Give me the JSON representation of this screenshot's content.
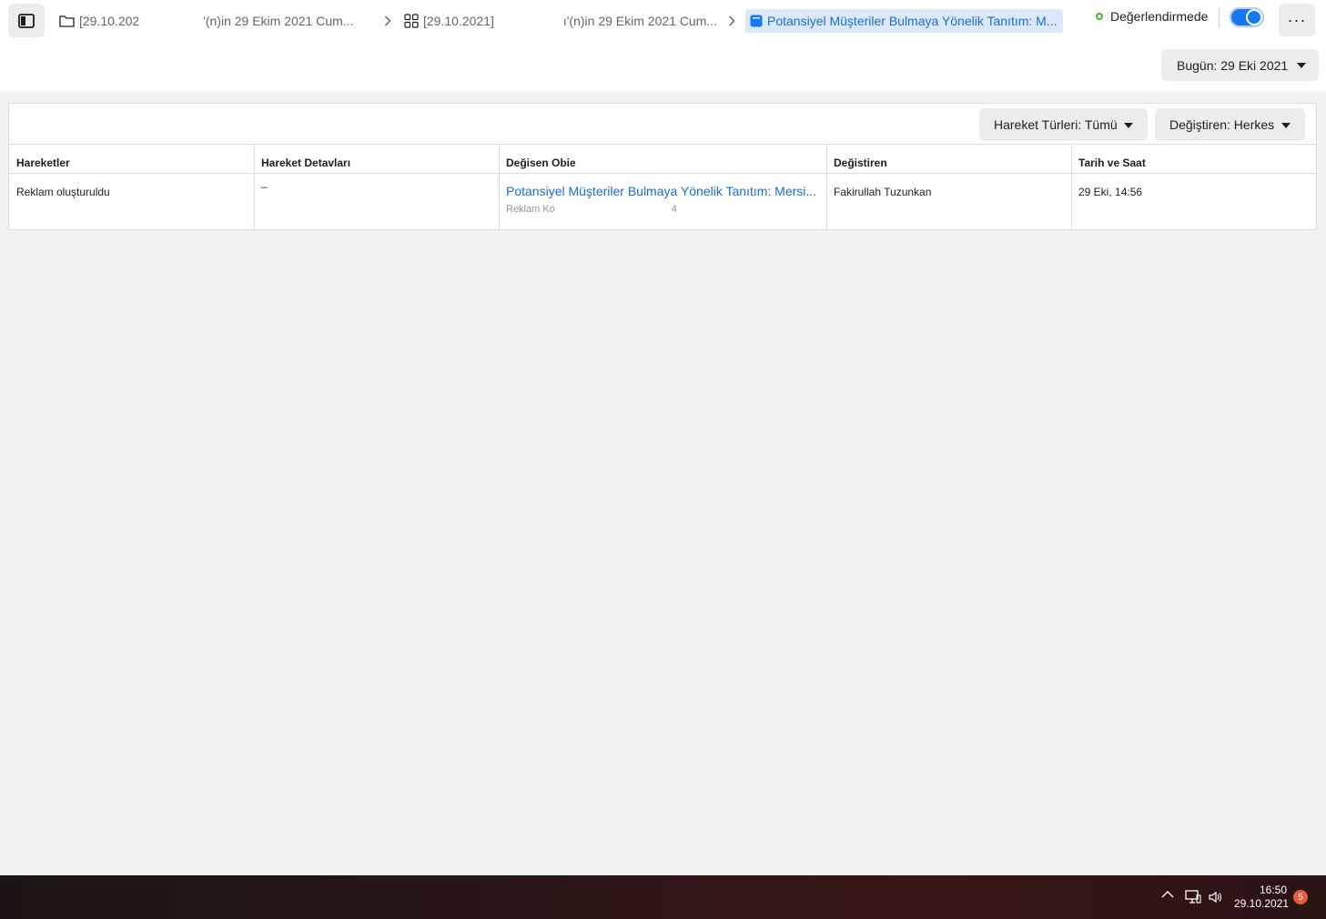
{
  "header": {
    "breadcrumbs": [
      {
        "text_start": "[29.10.202",
        "text_end": "'(n)in 29 Ekim 2021 Cum..."
      },
      {
        "text_start": "[29.10.2021]",
        "text_end": "ı'(n)in 29 Ekim 2021 Cum..."
      }
    ],
    "active_crumb": "Potansiyel Müşteriler Bulmaya Yönelik Tanıtım: M...",
    "status_label": "Değerlendirmede",
    "status_color": "#44b232",
    "toggle_on": true,
    "more_label": "···",
    "date_button": "Bugün: 29 Eki 2021"
  },
  "filters": {
    "action_types": "Hareket Türleri: Tümü",
    "changed_by": "Değiştiren: Herkes"
  },
  "table": {
    "headers": [
      "Hareketler",
      "Hareket Detavları",
      "Değisen Obie",
      "Değistiren",
      "Tarih ve Saat"
    ],
    "rows": [
      {
        "action": "Reklam oluşturuldu",
        "details": "–",
        "object_title": "Potansiyel Müşteriler Bulmaya Yönelik Tanıtım: Mersi...",
        "object_sub": "Reklam Ko",
        "object_sub_end": "4",
        "changed_by": "Fakirullah Tuzunkan",
        "datetime": "29 Eki, 14:56"
      }
    ]
  },
  "taskbar": {
    "time": "16:50",
    "date": "29.10.2021",
    "notifications": "5"
  },
  "icons": {
    "sidebar": "sidebar-toggle-icon",
    "folder": "folder-icon",
    "grid": "grid-icon",
    "ad": "ad-icon",
    "chevron": "chevron-right-icon"
  }
}
